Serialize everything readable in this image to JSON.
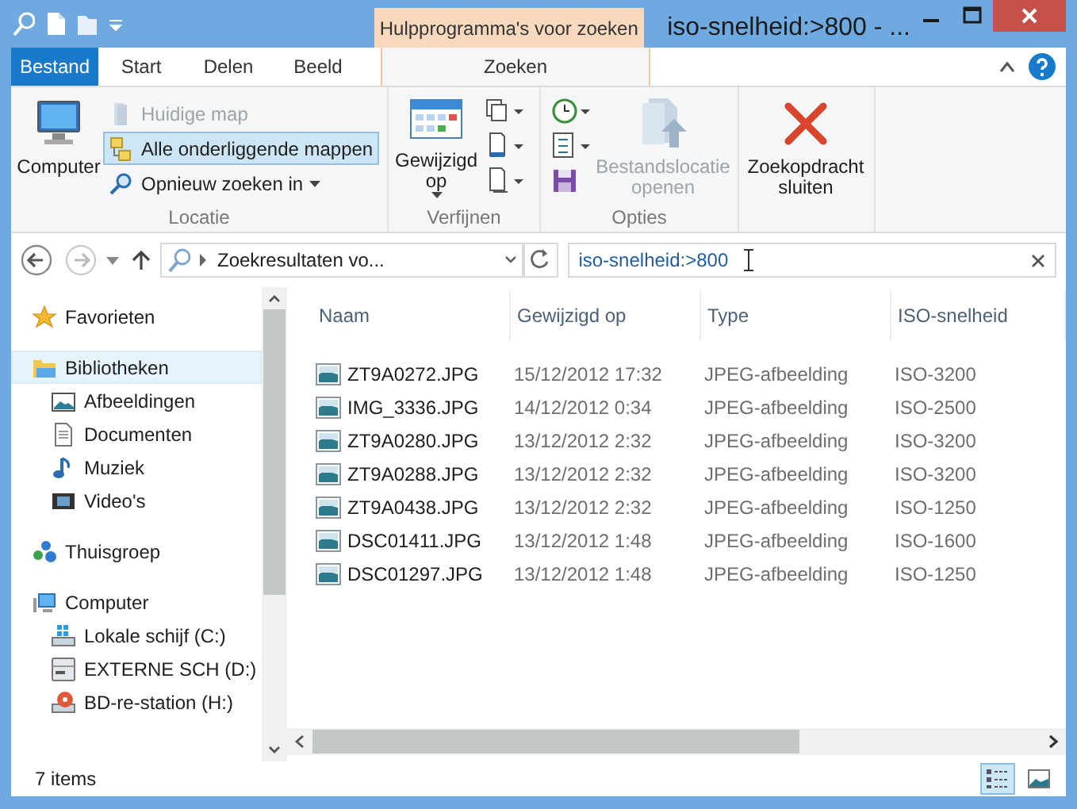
{
  "title_bar": {
    "contextual_tab": "Hulpprogramma's voor zoeken",
    "title": "iso-snelheid:>800 - ..."
  },
  "ribbon_tabs": [
    {
      "label": "Bestand",
      "kind": "file",
      "selected": false
    },
    {
      "label": "Start",
      "kind": "tab",
      "selected": false
    },
    {
      "label": "Delen",
      "kind": "tab",
      "selected": false
    },
    {
      "label": "Beeld",
      "kind": "tab",
      "selected": false
    },
    {
      "label": "Zoeken",
      "kind": "contextual",
      "selected": true
    }
  ],
  "ribbon": {
    "locatie": {
      "label": "Locatie",
      "large_button": "Computer",
      "options": [
        {
          "label": "Huidige map",
          "disabled": true,
          "selected": false,
          "dropdown": false
        },
        {
          "label": "Alle onderliggende mappen",
          "disabled": false,
          "selected": true,
          "dropdown": false
        },
        {
          "label": "Opnieuw zoeken in",
          "disabled": false,
          "selected": false,
          "dropdown": true
        }
      ]
    },
    "verfijnen": {
      "label": "Verfijnen",
      "large_button": "Gewijzigd op"
    },
    "opties": {
      "label": "Opties",
      "large_button": "Bestandslocatie openen",
      "large_disabled": true
    },
    "close": {
      "label": "Zoekopdracht sluiten"
    }
  },
  "address_bar": {
    "path": "Zoekresultaten vo...",
    "search": "iso-snelheid:>800"
  },
  "navigation": [
    {
      "label": "Favorieten",
      "selected": false
    },
    {
      "label": "Bibliotheken",
      "selected": true,
      "children": [
        {
          "label": "Afbeeldingen",
          "selected": false
        },
        {
          "label": "Documenten",
          "selected": false
        },
        {
          "label": "Muziek",
          "selected": false
        },
        {
          "label": "Video's",
          "selected": false
        }
      ]
    },
    {
      "label": "Thuisgroep",
      "selected": false
    },
    {
      "label": "Computer",
      "selected": false,
      "children": [
        {
          "label": "Lokale schijf (C:)",
          "selected": false
        },
        {
          "label": "EXTERNE SCH (D:)",
          "selected": false
        },
        {
          "label": "BD-re-station (H:)",
          "selected": false
        }
      ]
    }
  ],
  "table": {
    "columns": [
      "Naam",
      "Gewijzigd op",
      "Type",
      "ISO-snelheid"
    ],
    "rows": [
      [
        "ZT9A0272.JPG",
        "15/12/2012 17:32",
        "JPEG-afbeelding",
        "ISO-3200"
      ],
      [
        "IMG_3336.JPG",
        "14/12/2012 0:34",
        "JPEG-afbeelding",
        "ISO-2500"
      ],
      [
        "ZT9A0280.JPG",
        "13/12/2012 2:32",
        "JPEG-afbeelding",
        "ISO-3200"
      ],
      [
        "ZT9A0288.JPG",
        "13/12/2012 2:32",
        "JPEG-afbeelding",
        "ISO-3200"
      ],
      [
        "ZT9A0438.JPG",
        "13/12/2012 2:32",
        "JPEG-afbeelding",
        "ISO-1250"
      ],
      [
        "DSC01411.JPG",
        "13/12/2012 1:48",
        "JPEG-afbeelding",
        "ISO-1600"
      ],
      [
        "DSC01297.JPG",
        "13/12/2012 1:48",
        "JPEG-afbeelding",
        "ISO-1250"
      ]
    ]
  },
  "status_bar": {
    "count": "7 items",
    "views": [
      {
        "kind": "details",
        "selected": true
      },
      {
        "kind": "large_icons",
        "selected": false
      }
    ]
  }
}
